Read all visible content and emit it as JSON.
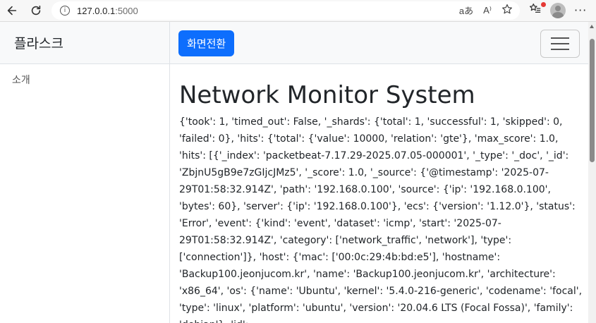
{
  "browser": {
    "url_host": "127.0.0.1",
    "url_port": ":5000",
    "translate_icon": "aあ",
    "read_aloud_icon": "A⁾"
  },
  "sidebar": {
    "brand": "플라스크",
    "items": [
      {
        "label": "소개"
      }
    ]
  },
  "topnav": {
    "toggle_label": "화면전환"
  },
  "main": {
    "title": "Network Monitor System",
    "dump": "{'took': 1, 'timed_out': False, '_shards': {'total': 1, 'successful': 1, 'skipped': 0, 'failed': 0}, 'hits': {'total': {'value': 10000, 'relation': 'gte'}, 'max_score': 1.0, 'hits': [{'_index': 'packetbeat-7.17.29-2025.07.05-000001', '_type': '_doc', '_id': 'ZbjnU5gB9e7zGIjcJMz5', '_score': 1.0, '_source': {'@timestamp': '2025-07-29T01:58:32.914Z', 'path': '192.168.0.100', 'source': {'ip': '192.168.0.100', 'bytes': 60}, 'server': {'ip': '192.168.0.100'}, 'ecs': {'version': '1.12.0'}, 'status': 'Error', 'event': {'kind': 'event', 'dataset': 'icmp', 'start': '2025-07-29T01:58:32.914Z', 'category': ['network_traffic', 'network'], 'type': ['connection']}, 'host': {'mac': ['00:0c:29:4b:bd:e5'], 'hostname': 'Backup100.jeonjucom.kr', 'name': 'Backup100.jeonjucom.kr', 'architecture': 'x86_64', 'os': {'name': 'Ubuntu', 'kernel': '5.4.0-216-generic', 'codename': 'focal', 'type': 'linux', 'platform': 'ubuntu', 'version': '20.04.6 LTS (Focal Fossa)', 'family': 'debian'}, 'id':"
  },
  "colors": {
    "primary": "#0d6efd",
    "navbar_bg": "#f8f9fa",
    "notification_dot": "#e53935"
  }
}
